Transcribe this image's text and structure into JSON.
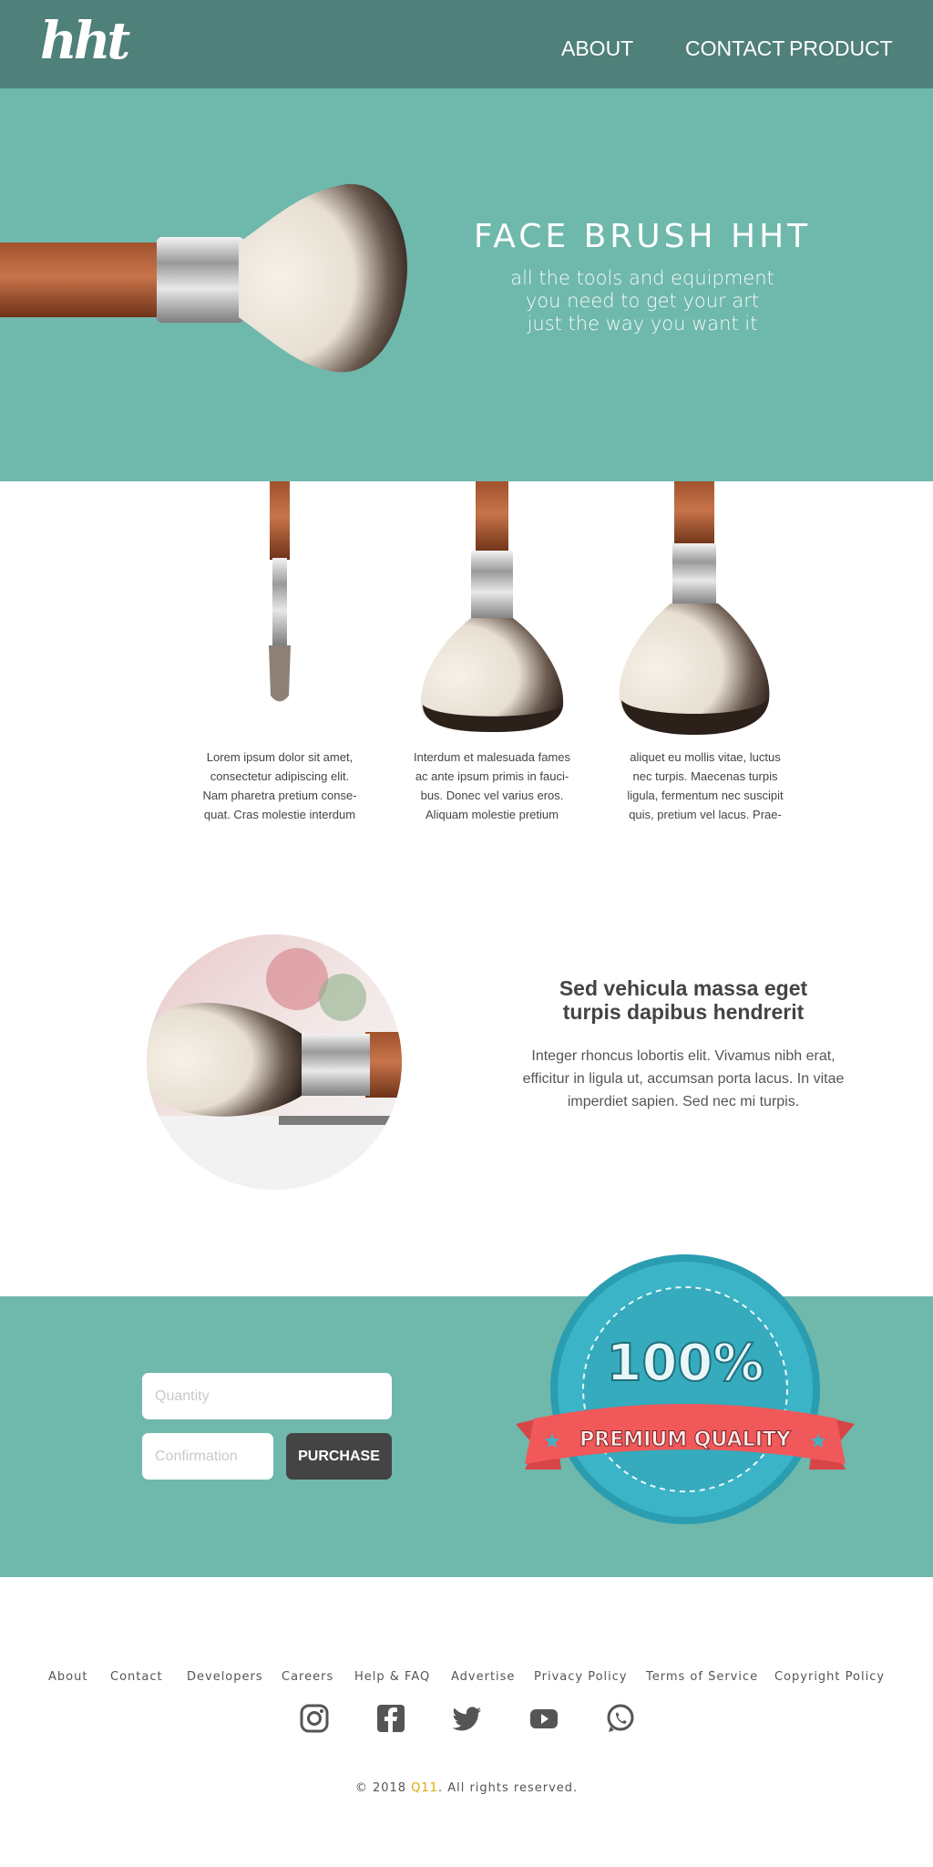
{
  "header": {
    "logo_text": "hht",
    "nav": {
      "about": "ABOUT",
      "contact": "CONTACT",
      "product": "PRODUCT"
    }
  },
  "hero": {
    "title": "FACE BRUSH HHT",
    "subtitle_lines": [
      "all the tools and equipment",
      "you need to get your art",
      "just the way you want it"
    ]
  },
  "products": [
    {
      "lines": [
        "Lorem ipsum dolor sit amet,",
        "consectetur adipiscing elit.",
        "Nam pharetra pretium conse-",
        "quat. Cras molestie interdum"
      ]
    },
    {
      "lines": [
        "Interdum et malesuada fames",
        "ac ante ipsum primis in fauci-",
        "bus. Donec vel varius eros.",
        "Aliquam molestie pretium"
      ]
    },
    {
      "lines": [
        "aliquet eu mollis vitae, luctus",
        "nec turpis. Maecenas turpis",
        "ligula, fermentum nec suscipit",
        "quis, pretium vel lacus. Prae-"
      ]
    }
  ],
  "feature": {
    "title_lines": [
      "Sed vehicula massa eget",
      "turpis dapibus hendrerit"
    ],
    "body_lines": [
      "Integer rhoncus lobortis elit. Vivamus nibh erat,",
      "efficitur in ligula ut, accumsan porta lacus. In vitae",
      "imperdiet sapien. Sed nec mi turpis."
    ]
  },
  "purchase": {
    "quantity_placeholder": "Quantity",
    "confirmation_placeholder": "Confirmation",
    "button_label": "PURCHASE",
    "badge_percent": "100%",
    "badge_ribbon": "PREMIUM QUALITY"
  },
  "footer": {
    "links": [
      "About",
      "Contact",
      "Developers",
      "Careers",
      "Help & FAQ",
      "Advertise",
      "Privacy Policy",
      "Terms of Service",
      "Copyright Policy"
    ],
    "socials": [
      "instagram-icon",
      "facebook-icon",
      "twitter-icon",
      "youtube-icon",
      "whatsapp-icon"
    ],
    "copyright_prefix": "© 2018 ",
    "copyright_brand": "Q11",
    "copyright_suffix": ". All rights reserved."
  },
  "colors": {
    "header_bg": "#4f8079",
    "teal": "#6fb8ac",
    "button_dark": "#444444",
    "brand_accent": "#e0a800",
    "badge_blue": "#3cb4c7",
    "ribbon_red": "#f0585a"
  }
}
